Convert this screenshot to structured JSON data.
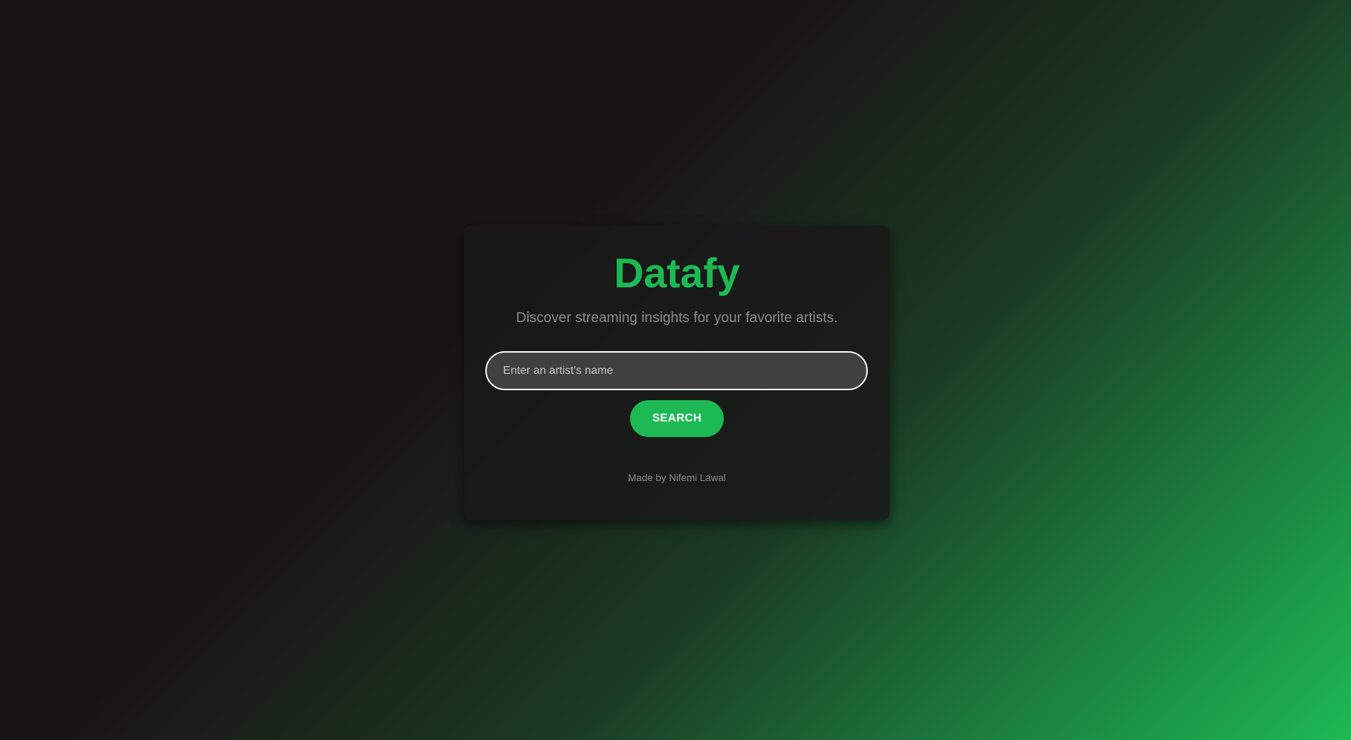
{
  "app": {
    "title": "Datafy",
    "subtitle": "Discover streaming insights for your favorite artists."
  },
  "search": {
    "value": "",
    "placeholder": "Enter an artist's name",
    "button_label": "SEARCH"
  },
  "footer": {
    "credit": "Made by Nifemi Lawal"
  },
  "colors": {
    "accent": "#1db954",
    "background_dark": "#191414",
    "card": "#191919",
    "input_background": "#404040",
    "muted_text": "#8a8a8a"
  }
}
